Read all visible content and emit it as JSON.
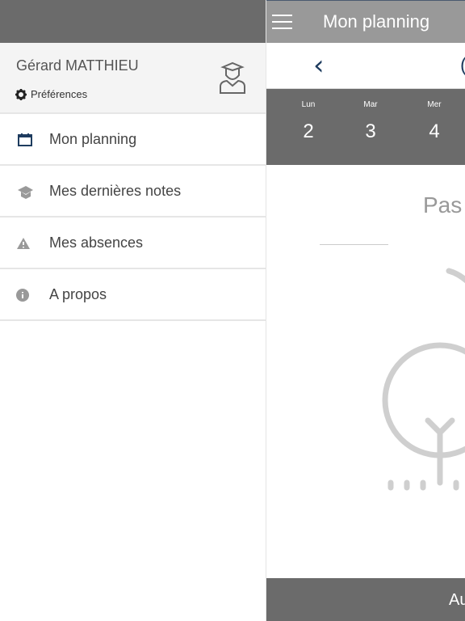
{
  "app": {
    "title": "Mon planning",
    "nav_fragment": "(",
    "empty_text": "Pas",
    "footer_text": "Au",
    "days": [
      {
        "name": "Lun",
        "num": "2"
      },
      {
        "name": "Mar",
        "num": "3"
      },
      {
        "name": "Mer",
        "num": "4"
      }
    ]
  },
  "drawer": {
    "user_name": "Gérard MATTHIEU",
    "preferences": "Préférences",
    "items": [
      {
        "label": "Mon planning",
        "icon": "calendar-icon"
      },
      {
        "label": "Mes dernières notes",
        "icon": "graduation-cap-icon"
      },
      {
        "label": "Mes absences",
        "icon": "warning-icon"
      },
      {
        "label": "A propos",
        "icon": "info-icon"
      }
    ]
  },
  "colors": {
    "accent": "#1e3c5f",
    "header_gray": "#6b6b6b",
    "appbar": "#999999"
  }
}
